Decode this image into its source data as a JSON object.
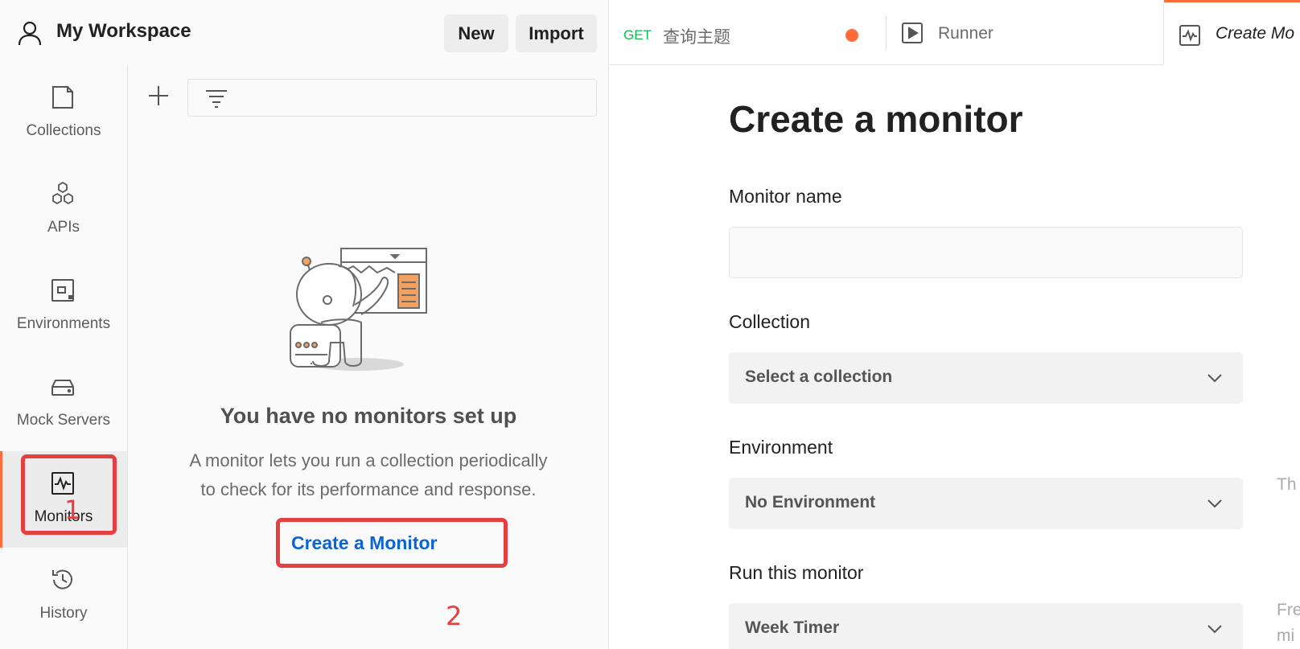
{
  "header": {
    "workspace": "My Workspace",
    "new_label": "New",
    "import_label": "Import",
    "tabs": [
      {
        "method": "GET",
        "name": "查询主题",
        "unsaved": true
      },
      {
        "name": "Runner"
      },
      {
        "name": "Create Mo"
      }
    ]
  },
  "nav": {
    "items": [
      {
        "label": "Collections",
        "icon": "collections-icon"
      },
      {
        "label": "APIs",
        "icon": "apis-icon"
      },
      {
        "label": "Environments",
        "icon": "environments-icon"
      },
      {
        "label": "Mock Servers",
        "icon": "mock-servers-icon"
      },
      {
        "label": "Monitors",
        "icon": "monitors-icon",
        "active": true
      },
      {
        "label": "History",
        "icon": "history-icon"
      }
    ]
  },
  "annotations": {
    "one": "1",
    "two": "2",
    "color": "#e5403f"
  },
  "sidebar": {
    "empty_title": "You have no monitors set up",
    "empty_desc_line1": "A monitor lets you run a collection periodically",
    "empty_desc_line2": "to check for its performance and response.",
    "create_link": "Create a Monitor"
  },
  "form": {
    "title": "Create a monitor",
    "monitor_name_label": "Monitor name",
    "monitor_name_value": "",
    "collection_label": "Collection",
    "collection_value": "Select a collection",
    "environment_label": "Environment",
    "environment_value": "No Environment",
    "environment_hint": "Th",
    "run_label": "Run this monitor",
    "run_value": "Week Timer",
    "run_hint_line1": "Fre",
    "run_hint_line2": "mi"
  },
  "colors": {
    "accent": "#ff6c37",
    "link": "#0c63d6",
    "get_method": "#0cbb52"
  }
}
